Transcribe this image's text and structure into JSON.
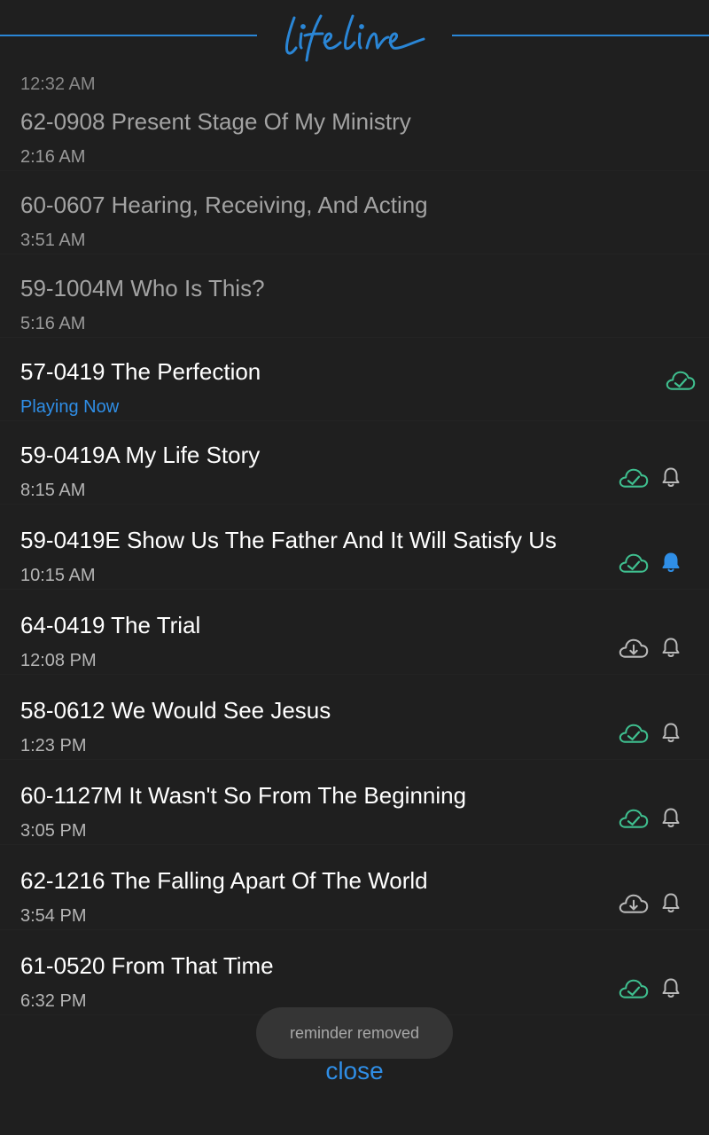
{
  "app": {
    "name": "lifeline",
    "accent": "#2f8ee6",
    "downloaded_color": "#3fbf8f"
  },
  "cut_off_time": "12:32 AM",
  "items": [
    {
      "title": "62-0908 Present Stage Of My Ministry",
      "subtitle": "2:16 AM",
      "state": "past"
    },
    {
      "title": "60-0607 Hearing, Receiving, And Acting",
      "subtitle": "3:51 AM",
      "state": "past"
    },
    {
      "title": "59-1004M Who Is This?",
      "subtitle": "5:16 AM",
      "state": "past"
    },
    {
      "title": "57-0419 The Perfection",
      "subtitle": "Playing Now",
      "state": "playing",
      "download": "cloud-check-icon"
    },
    {
      "title": "59-0419A My Life Story",
      "subtitle": "8:15 AM",
      "state": "upcoming",
      "download": "cloud-check-icon",
      "reminder": "bell-outline-icon"
    },
    {
      "title": "59-0419E Show Us The Father And It Will Satisfy Us",
      "subtitle": "10:15 AM",
      "state": "upcoming",
      "download": "cloud-check-icon",
      "reminder": "bell-filled-icon"
    },
    {
      "title": "64-0419 The Trial",
      "subtitle": "12:08 PM",
      "state": "upcoming",
      "download": "cloud-download-icon",
      "reminder": "bell-outline-icon"
    },
    {
      "title": "58-0612 We Would See Jesus",
      "subtitle": "1:23 PM",
      "state": "upcoming",
      "download": "cloud-check-icon",
      "reminder": "bell-outline-icon"
    },
    {
      "title": "60-1127M It Wasn't So From The Beginning",
      "subtitle": "3:05 PM",
      "state": "upcoming",
      "download": "cloud-check-icon",
      "reminder": "bell-outline-icon"
    },
    {
      "title": "62-1216 The Falling Apart Of The World",
      "subtitle": "3:54 PM",
      "state": "upcoming",
      "download": "cloud-download-icon",
      "reminder": "bell-outline-icon"
    },
    {
      "title": "61-0520 From That Time",
      "subtitle": "6:32 PM",
      "state": "upcoming",
      "download": "cloud-check-icon",
      "reminder": "bell-outline-icon"
    }
  ],
  "toast": "reminder removed",
  "close_label": "close"
}
